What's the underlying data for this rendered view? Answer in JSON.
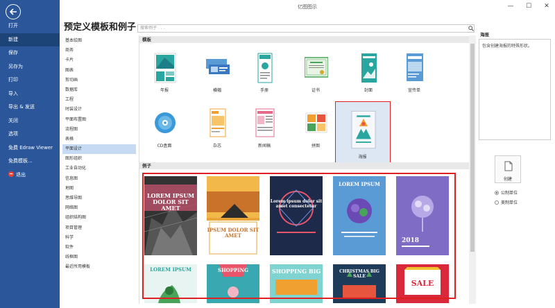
{
  "window": {
    "title": "亿图图示",
    "minimize": "—",
    "maximize": "☐",
    "close": "✕"
  },
  "nav": {
    "items": [
      {
        "label": "打开"
      },
      {
        "label": "新建"
      },
      {
        "label": "保存"
      },
      {
        "label": "另存为"
      },
      {
        "label": "打印"
      },
      {
        "label": "导入"
      },
      {
        "label": "导出 & 发送"
      },
      {
        "label": "关闭"
      },
      {
        "label": "选项"
      },
      {
        "label": "免费 Edraw Viewer"
      },
      {
        "label": "免费模板..."
      },
      {
        "label": "退出"
      }
    ],
    "active": "新建"
  },
  "main": {
    "heading": "预定义模板和例子",
    "search_placeholder": "搜索例子 . . .",
    "categories": [
      "基本绘图",
      "商务",
      "卡片",
      "图表",
      "剪切画",
      "数据库",
      "工程",
      "时装设计",
      "平面布置图",
      "流程图",
      "表格",
      "平面设计",
      "图形组织",
      "工业自动化",
      "信息图",
      "地图",
      "思维导图",
      "网络图",
      "组织结构图",
      "项目管理",
      "科学",
      "软件",
      "线框图",
      "最近所用模板"
    ],
    "active_category": "平面设计",
    "templates_header": "模板",
    "templates": [
      {
        "label": "年报",
        "icon": "annual-report-icon"
      },
      {
        "label": "横幅",
        "icon": "banner-icon"
      },
      {
        "label": "手册",
        "icon": "brochure-icon"
      },
      {
        "label": "证书",
        "icon": "certificate-icon"
      },
      {
        "label": "封面",
        "icon": "cover-icon"
      },
      {
        "label": "宣传单",
        "icon": "flyer-icon"
      },
      {
        "label": "CD盒面",
        "icon": "cd-icon"
      },
      {
        "label": "杂志",
        "icon": "magazine-icon"
      },
      {
        "label": "新闻稿",
        "icon": "newsletter-icon"
      },
      {
        "label": "拼图",
        "icon": "collage-icon"
      },
      {
        "label": "海报",
        "icon": "poster-icon"
      }
    ],
    "selected_template": "海报",
    "examples_header": "例子",
    "examples": [
      {
        "text": "LOREM IPSUM DOLOR SIT AMET"
      },
      {
        "text": "IPSUM DOLOR SIT AMET"
      },
      {
        "text": "Lorem ipsum dolor sit amet consectetur"
      },
      {
        "text": "LOREM IPSUM"
      },
      {
        "text": "2018"
      },
      {
        "text": "LOREM IPSUM"
      },
      {
        "text": "SHOPPING"
      },
      {
        "text": "SHOPPING BIG"
      },
      {
        "text": "CHRISTMAS BIG SALE"
      },
      {
        "text": "SALE"
      }
    ]
  },
  "right_panel": {
    "title": "海报",
    "description": "包含创建海报的特殊形状。",
    "create_label": "创建",
    "unit_options": [
      "公制单位",
      "美制单位"
    ],
    "selected_unit": "公制单位"
  },
  "colors": {
    "nav_bg": "#2b579a",
    "highlight": "#e02020",
    "selection_bg": "#c6dbf3"
  }
}
